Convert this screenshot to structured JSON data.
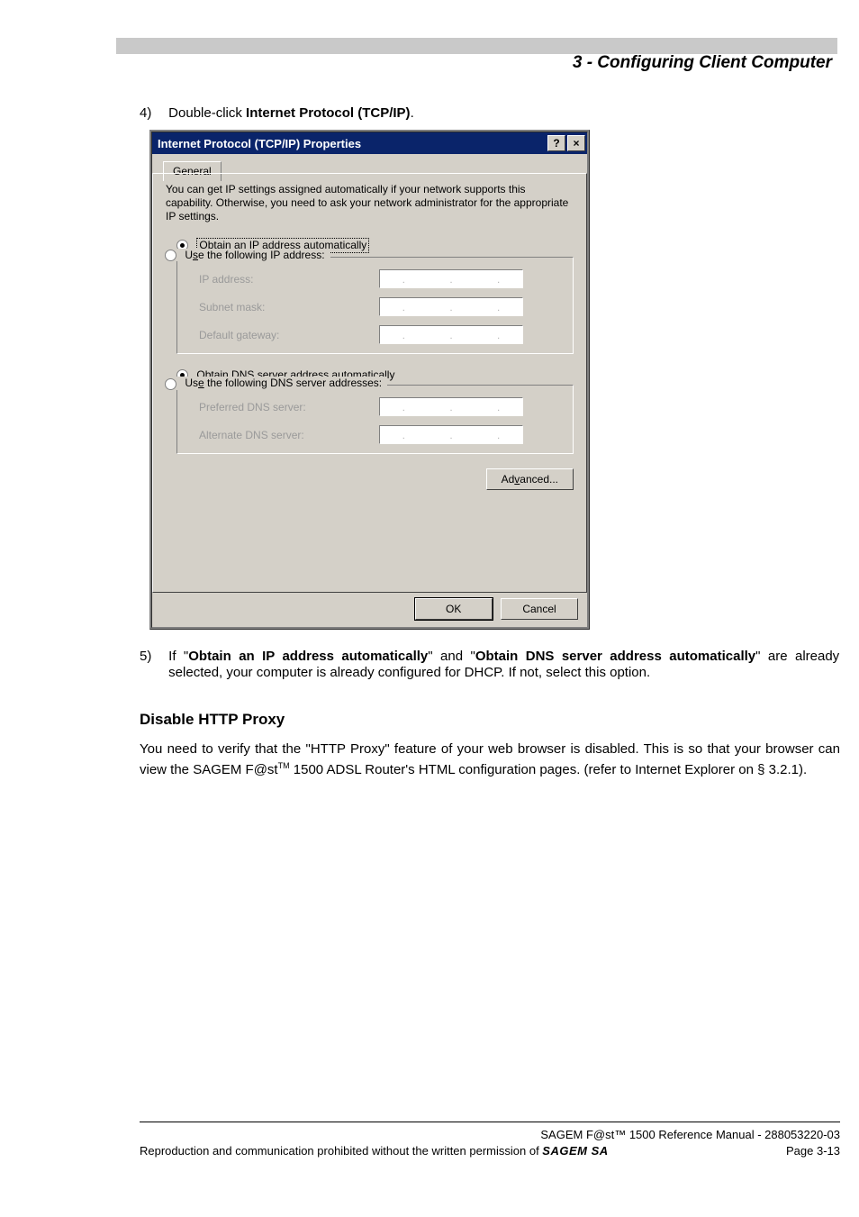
{
  "header": {
    "chapter_title": "3 - Configuring Client Computer"
  },
  "step4": {
    "number": "4)",
    "text_before_bold": "Double-click ",
    "text_bold": "Internet Protocol (TCP/IP)",
    "text_after_bold": "."
  },
  "dialog": {
    "title": "Internet Protocol (TCP/IP) Properties",
    "help_icon": "?",
    "close_icon": "×",
    "tab_label": "General",
    "intro": "You can get IP settings assigned automatically if your network supports this capability. Otherwise, you need to ask your network administrator for the appropriate IP settings.",
    "radio_auto_ip_prefix": "O",
    "radio_auto_ip_rest": "btain an IP address automatically",
    "radio_static_ip_prefix": "s",
    "radio_static_ip_pre": "U",
    "radio_static_ip_rest": "e the following IP address:",
    "labels": {
      "ip": "IP address:",
      "subnet": "Subnet mask:",
      "gateway": "Default gateway:",
      "pref_dns": "Preferred DNS server:",
      "alt_dns": "Alternate DNS server:"
    },
    "radio_auto_dns_pre": "O",
    "radio_auto_dns_key": "b",
    "radio_auto_dns_rest": "tain DNS server address automatically",
    "radio_static_dns_pre": "Us",
    "radio_static_dns_key": "e",
    "radio_static_dns_rest": " the following DNS server addresses:",
    "advanced_pre": "Ad",
    "advanced_key": "v",
    "advanced_rest": "anced...",
    "ok": "OK",
    "cancel": "Cancel"
  },
  "step5": {
    "number": "5)",
    "t1": "If \"",
    "b1": "Obtain an IP address automatically",
    "t2": "\" and \"",
    "b2": "Obtain DNS server address automatically",
    "t3": "\" are already selected, your computer is already configured for DHCP. If not, select this option."
  },
  "h_disable": "Disable HTTP Proxy",
  "proxy_para": {
    "p1": "You need to verify that the \"HTTP Proxy\" feature of your web browser is disabled. This is so that your browser can view the SAGEM F@st",
    "tm": "TM",
    "p2": " 1500 ADSL Router's HTML configuration pages. (refer to Internet Explorer on § 3.2.1)."
  },
  "footer": {
    "line1": "SAGEM F@st™ 1500 Reference Manual - 288053220-03",
    "line2_left_pre": "Reproduction and communication prohibited without the written permission of ",
    "line2_left_brand": "SAGEM SA",
    "line2_right": "Page 3-13"
  }
}
